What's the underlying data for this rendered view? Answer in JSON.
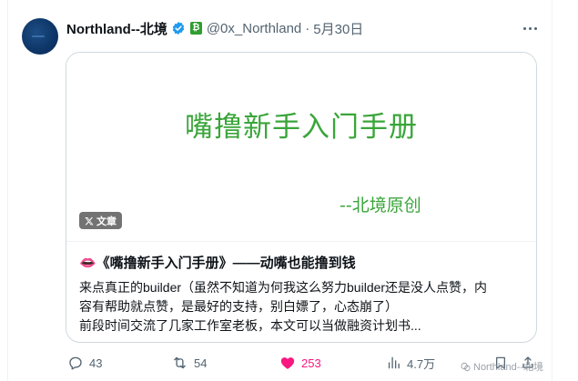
{
  "author": {
    "name": "Northland--北境",
    "handle": "@0x_Northland",
    "date": "5月30日",
    "separator": "·",
    "verified_icon": "verified-badge-icon",
    "affiliation_badge": "₿"
  },
  "card": {
    "cover_title": "嘴撸新手入门手册",
    "cover_subtitle": "--北境原创",
    "type_badge": "文章",
    "title": "👄《嘴撸新手入门手册》——动嘴也能撸到钱",
    "description_lines": [
      "来点真正的builder（虽然不知道为何我这么努力builder还是没人点赞，内",
      "容有帮助就点赞，是最好的支持，别白嫖了，心态崩了）",
      "前段时间交流了几家工作室老板，本文可以当做融资计划书..."
    ]
  },
  "actions": {
    "replies": "43",
    "reposts": "54",
    "likes": "253",
    "views": "4.7万"
  },
  "watermark": "Northland--北境",
  "colors": {
    "accent_green": "#3aa53a",
    "like_pink": "#f91880",
    "verified_blue": "#1d9bf0",
    "muted_text": "#536471"
  }
}
